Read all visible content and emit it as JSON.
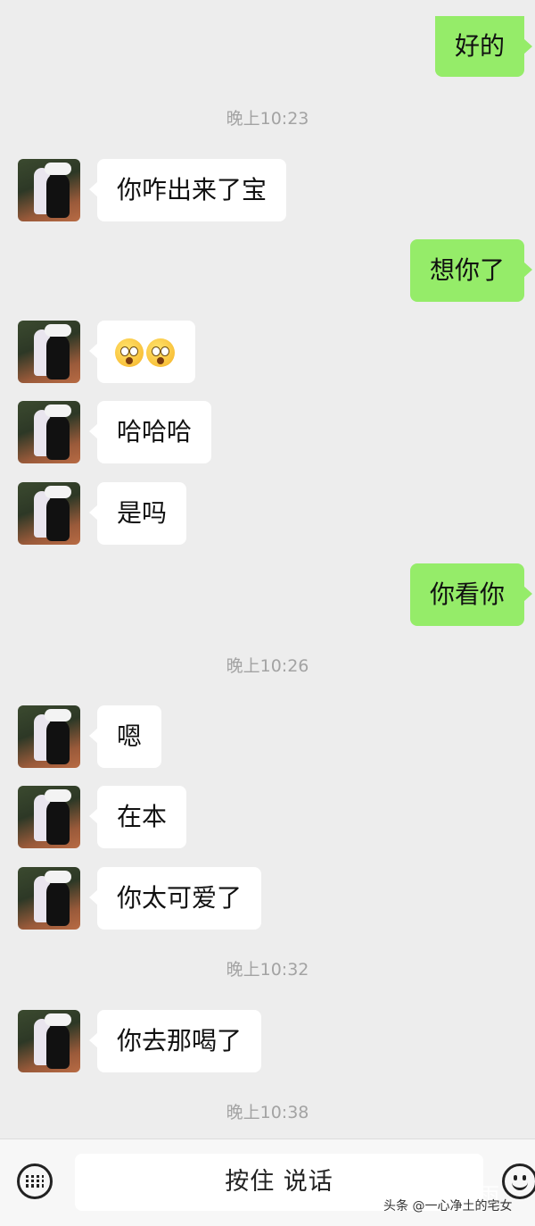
{
  "messages": [
    {
      "side": "right",
      "text": "好的"
    },
    {
      "time": "晚上10:23"
    },
    {
      "side": "left",
      "text": "你咋出来了宝"
    },
    {
      "side": "right",
      "text": "想你了"
    },
    {
      "side": "left",
      "emoji": [
        "astonished-face-emoji",
        "astonished-face-emoji"
      ]
    },
    {
      "side": "left",
      "text": "哈哈哈"
    },
    {
      "side": "left",
      "text": "是吗"
    },
    {
      "side": "right",
      "text": "你看你"
    },
    {
      "time": "晚上10:26"
    },
    {
      "side": "left",
      "text": "嗯"
    },
    {
      "side": "left",
      "text": "在本"
    },
    {
      "side": "left",
      "text": "你太可爱了"
    },
    {
      "time": "晚上10:32"
    },
    {
      "side": "left",
      "text": "你去那喝了"
    },
    {
      "time": "晚上10:38"
    }
  ],
  "input_bar": {
    "keyboard_icon": "keyboard-icon",
    "hold_to_talk_label": "按住 说话",
    "emoji_icon": "emoji-smiley-icon"
  },
  "watermark": {
    "text": "头条 @一心净土的宅女",
    "logo_text": "朝云雨"
  },
  "colors": {
    "background": "#ededed",
    "sent_bubble": "#95ec69",
    "received_bubble": "#ffffff",
    "timestamp": "#a3a3a3"
  }
}
